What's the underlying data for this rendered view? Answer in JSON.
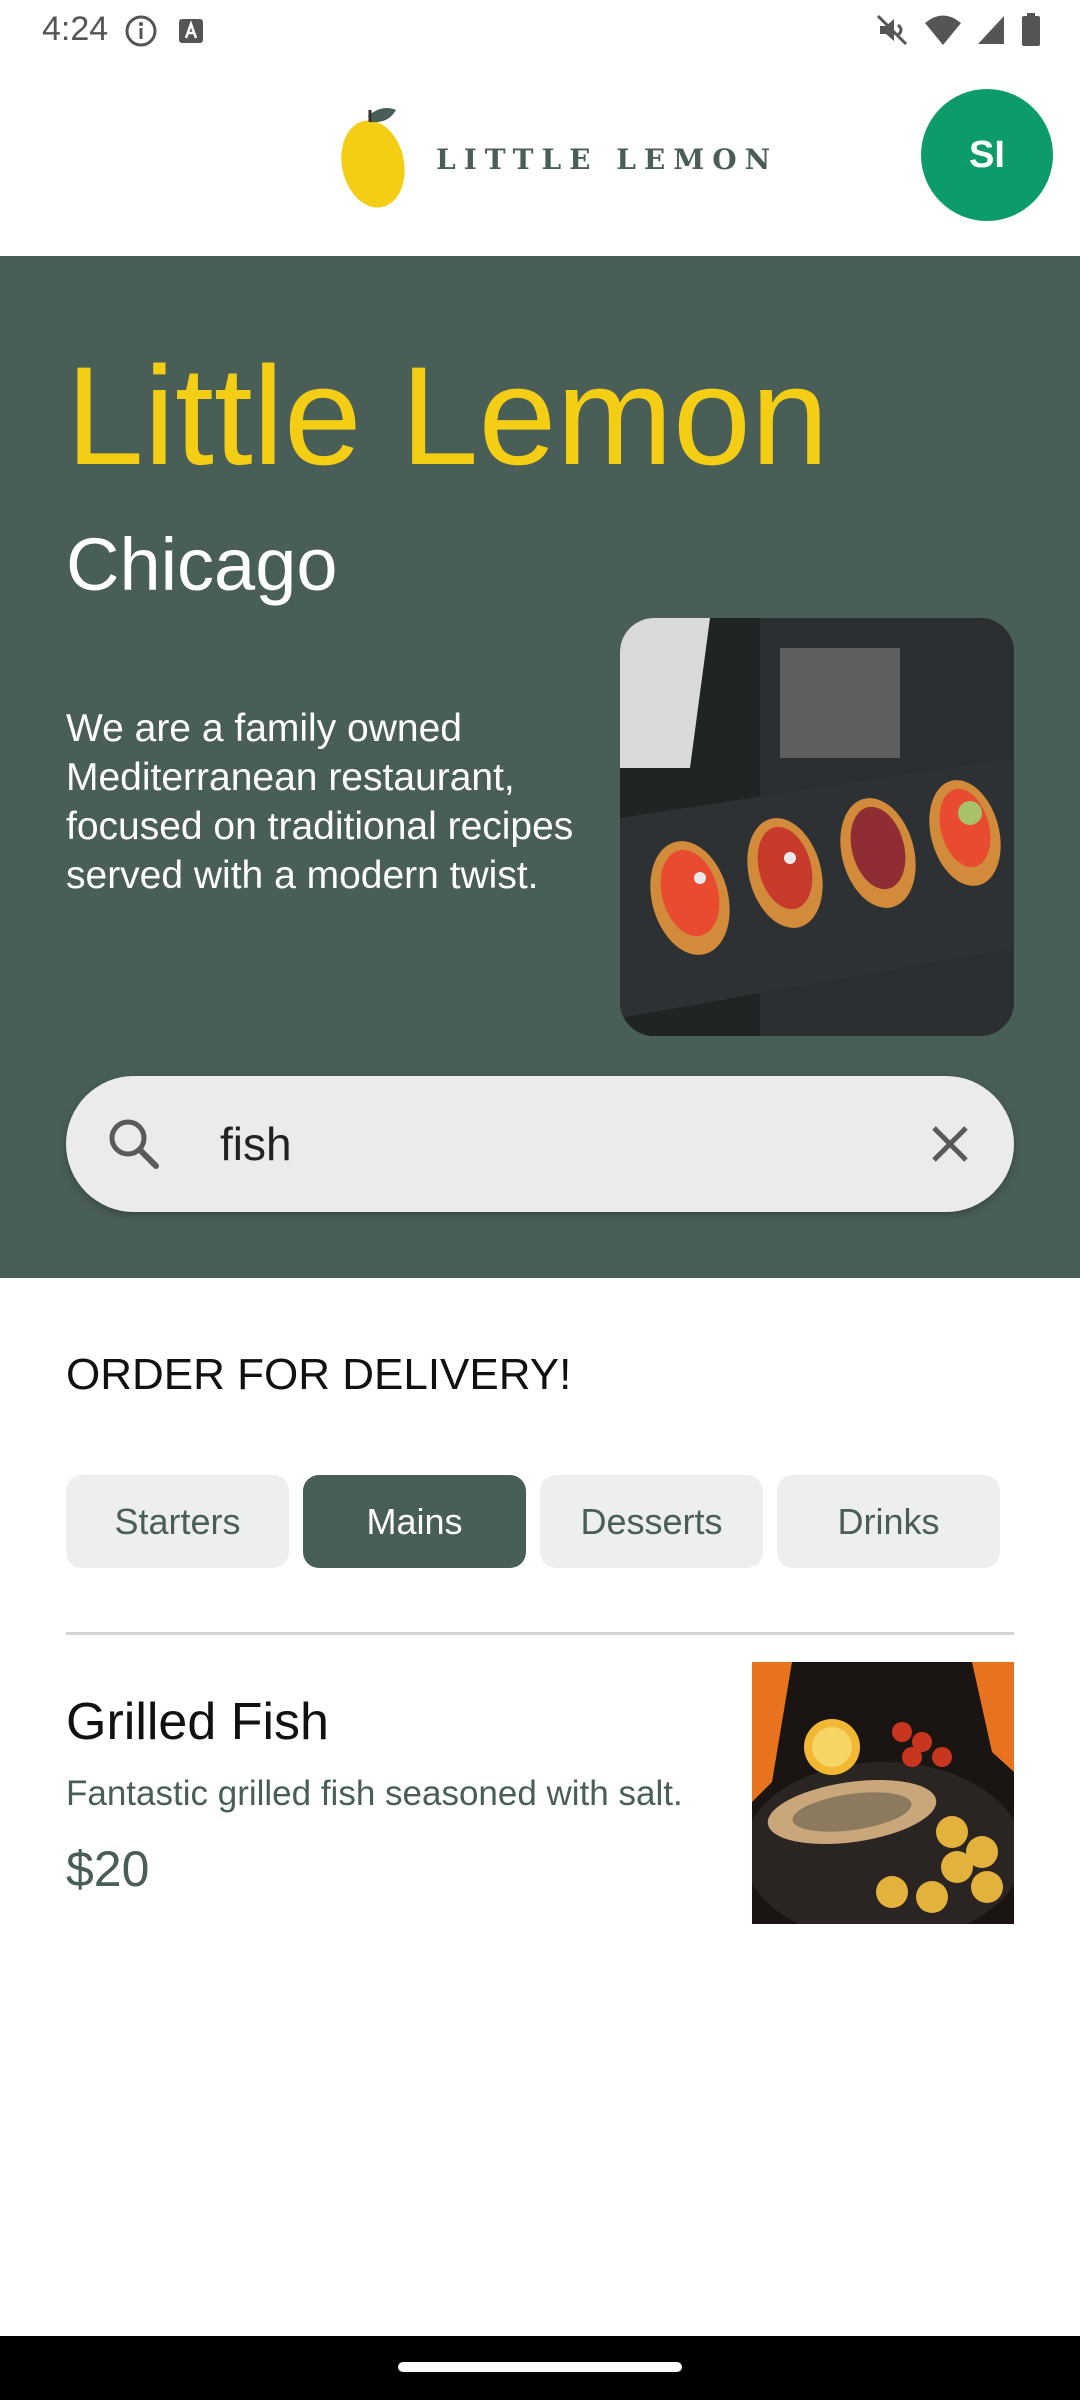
{
  "status_bar": {
    "time": "4:24",
    "left_icons": [
      "info-icon",
      "keyboard-a-icon"
    ],
    "right_icons": [
      "mute-icon",
      "wifi-icon",
      "signal-icon",
      "battery-icon"
    ]
  },
  "header": {
    "logo_text": "LITTLE LEMON",
    "avatar_initials": "SI"
  },
  "hero": {
    "title": "Little Lemon",
    "subtitle": "Chicago",
    "description": "We are a family owned Mediterranean restaurant, focused on traditional recipes served with a modern twist.",
    "image_icon": "bruschetta-platter-image"
  },
  "search": {
    "value": "fish",
    "placeholder": "",
    "search_icon": "search-icon",
    "clear_icon": "close-icon"
  },
  "order": {
    "title": "ORDER FOR DELIVERY!",
    "categories": [
      {
        "label": "Starters",
        "selected": false
      },
      {
        "label": "Mains",
        "selected": true
      },
      {
        "label": "Desserts",
        "selected": false
      },
      {
        "label": "Drinks",
        "selected": false
      }
    ]
  },
  "menu_items": [
    {
      "name": "Grilled Fish",
      "description": "Fantastic grilled fish seasoned with salt.",
      "price": "$20",
      "image_icon": "grilled-fish-image"
    }
  ],
  "colors": {
    "primary_green": "#495e57",
    "primary_yellow": "#f4ce14",
    "avatar_green": "#0d9b6a",
    "chip_bg": "#edefee"
  }
}
